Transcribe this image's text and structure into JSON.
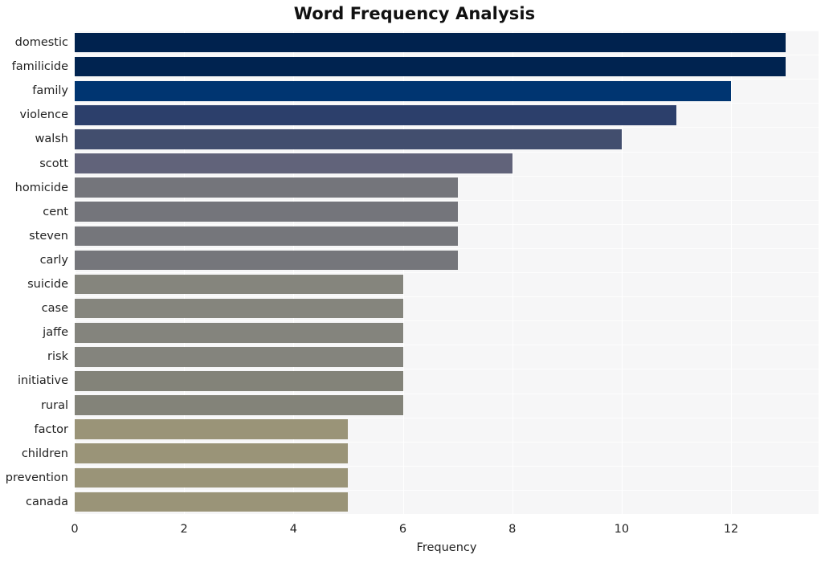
{
  "chart_data": {
    "type": "bar",
    "orientation": "horizontal",
    "title": "Word Frequency Analysis",
    "xlabel": "Frequency",
    "ylabel": "",
    "categories": [
      "domestic",
      "familicide",
      "family",
      "violence",
      "walsh",
      "scott",
      "homicide",
      "cent",
      "steven",
      "carly",
      "suicide",
      "case",
      "jaffe",
      "risk",
      "initiative",
      "rural",
      "factor",
      "children",
      "prevention",
      "canada"
    ],
    "values": [
      13,
      13,
      12,
      11,
      10,
      8,
      7,
      7,
      7,
      7,
      6,
      6,
      6,
      6,
      6,
      6,
      5,
      5,
      5,
      5
    ],
    "bar_colors": [
      "#00224e",
      "#002350",
      "#003571",
      "#2c3f6b",
      "#424e6e",
      "#61637a",
      "#74757b",
      "#74757b",
      "#75767b",
      "#75767b",
      "#85857d",
      "#85857d",
      "#84847d",
      "#84847d",
      "#838379",
      "#838379",
      "#9a9478",
      "#9a9478",
      "#9a9478",
      "#9a9478"
    ],
    "xticks": [
      0,
      2,
      4,
      6,
      8,
      10,
      12
    ],
    "xtick_labels": [
      "0",
      "2",
      "4",
      "6",
      "8",
      "10",
      "12"
    ],
    "xlim": [
      0,
      13.6
    ],
    "grid": true,
    "grid_color": "#ffffff",
    "plot_background": "#f6f6f7",
    "figure_background": "#ffffff",
    "legend": null
  }
}
